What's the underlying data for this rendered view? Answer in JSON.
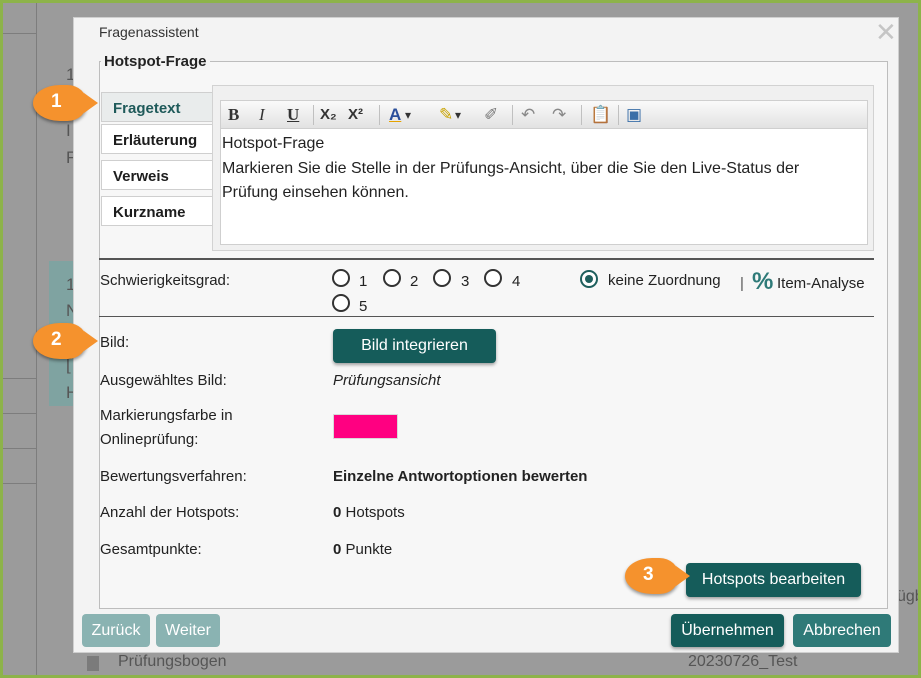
{
  "dialog": {
    "title": "Fragenassistent"
  },
  "section": {
    "legend": "Hotspot-Frage"
  },
  "tabs": [
    {
      "label": "Fragetext"
    },
    {
      "label": "Erläuterung"
    },
    {
      "label": "Verweis"
    },
    {
      "label": "Kurzname"
    }
  ],
  "toolbar": {
    "bold": "B",
    "italic": "I",
    "underline": "U",
    "subscript": "X₂",
    "superscript": "X²",
    "font_color": "A",
    "dropdown_arrow": "▾"
  },
  "editor": {
    "lines": [
      "Hotspot-Frage",
      "Markieren Sie die Stelle in der Prüfungs-Ansicht, über die Sie den Live-Status der",
      "Prüfung einsehen können."
    ]
  },
  "difficulty": {
    "label": "Schwierigkeitsgrad:",
    "options": [
      "1",
      "2",
      "3",
      "4",
      "5"
    ],
    "none_label": "keine Zuordnung",
    "separator": "|",
    "item_analysis": "Item-Analyse",
    "percent_symbol": "%"
  },
  "image": {
    "label": "Bild:",
    "button": "Bild integrieren",
    "selected_label": "Ausgewähltes Bild:",
    "selected_value": "Prüfungsansicht",
    "color_label_1": "Markierungsfarbe in",
    "color_label_2": "Onlineprüfung:",
    "marker_color": "#ff0081"
  },
  "scoring": {
    "method_label": "Bewertungsverfahren:",
    "method_value": "Einzelne Antwortoptionen bewerten",
    "hotspots_label": "Anzahl der Hotspots:",
    "hotspots_count": "0",
    "hotspots_unit": "Hotspots",
    "points_label": "Gesamtpunkte:",
    "points_count": "0",
    "points_unit": "Punkte"
  },
  "buttons": {
    "edit_hotspots": "Hotspots bearbeiten",
    "back": "Zurück",
    "next": "Weiter",
    "apply": "Übernehmen",
    "cancel": "Abbrechen"
  },
  "callouts": [
    "1",
    "2",
    "3"
  ],
  "background": {
    "row_left": "Prüfungsbogen",
    "row_right": "20230726_Test",
    "cut_right": "ügb",
    "chars": [
      "1",
      "I",
      "F",
      "1",
      "N",
      "[",
      "H"
    ]
  },
  "colors": {
    "accent": "#155c5a",
    "callout": "#f5922d",
    "frame": "#8db34a"
  }
}
